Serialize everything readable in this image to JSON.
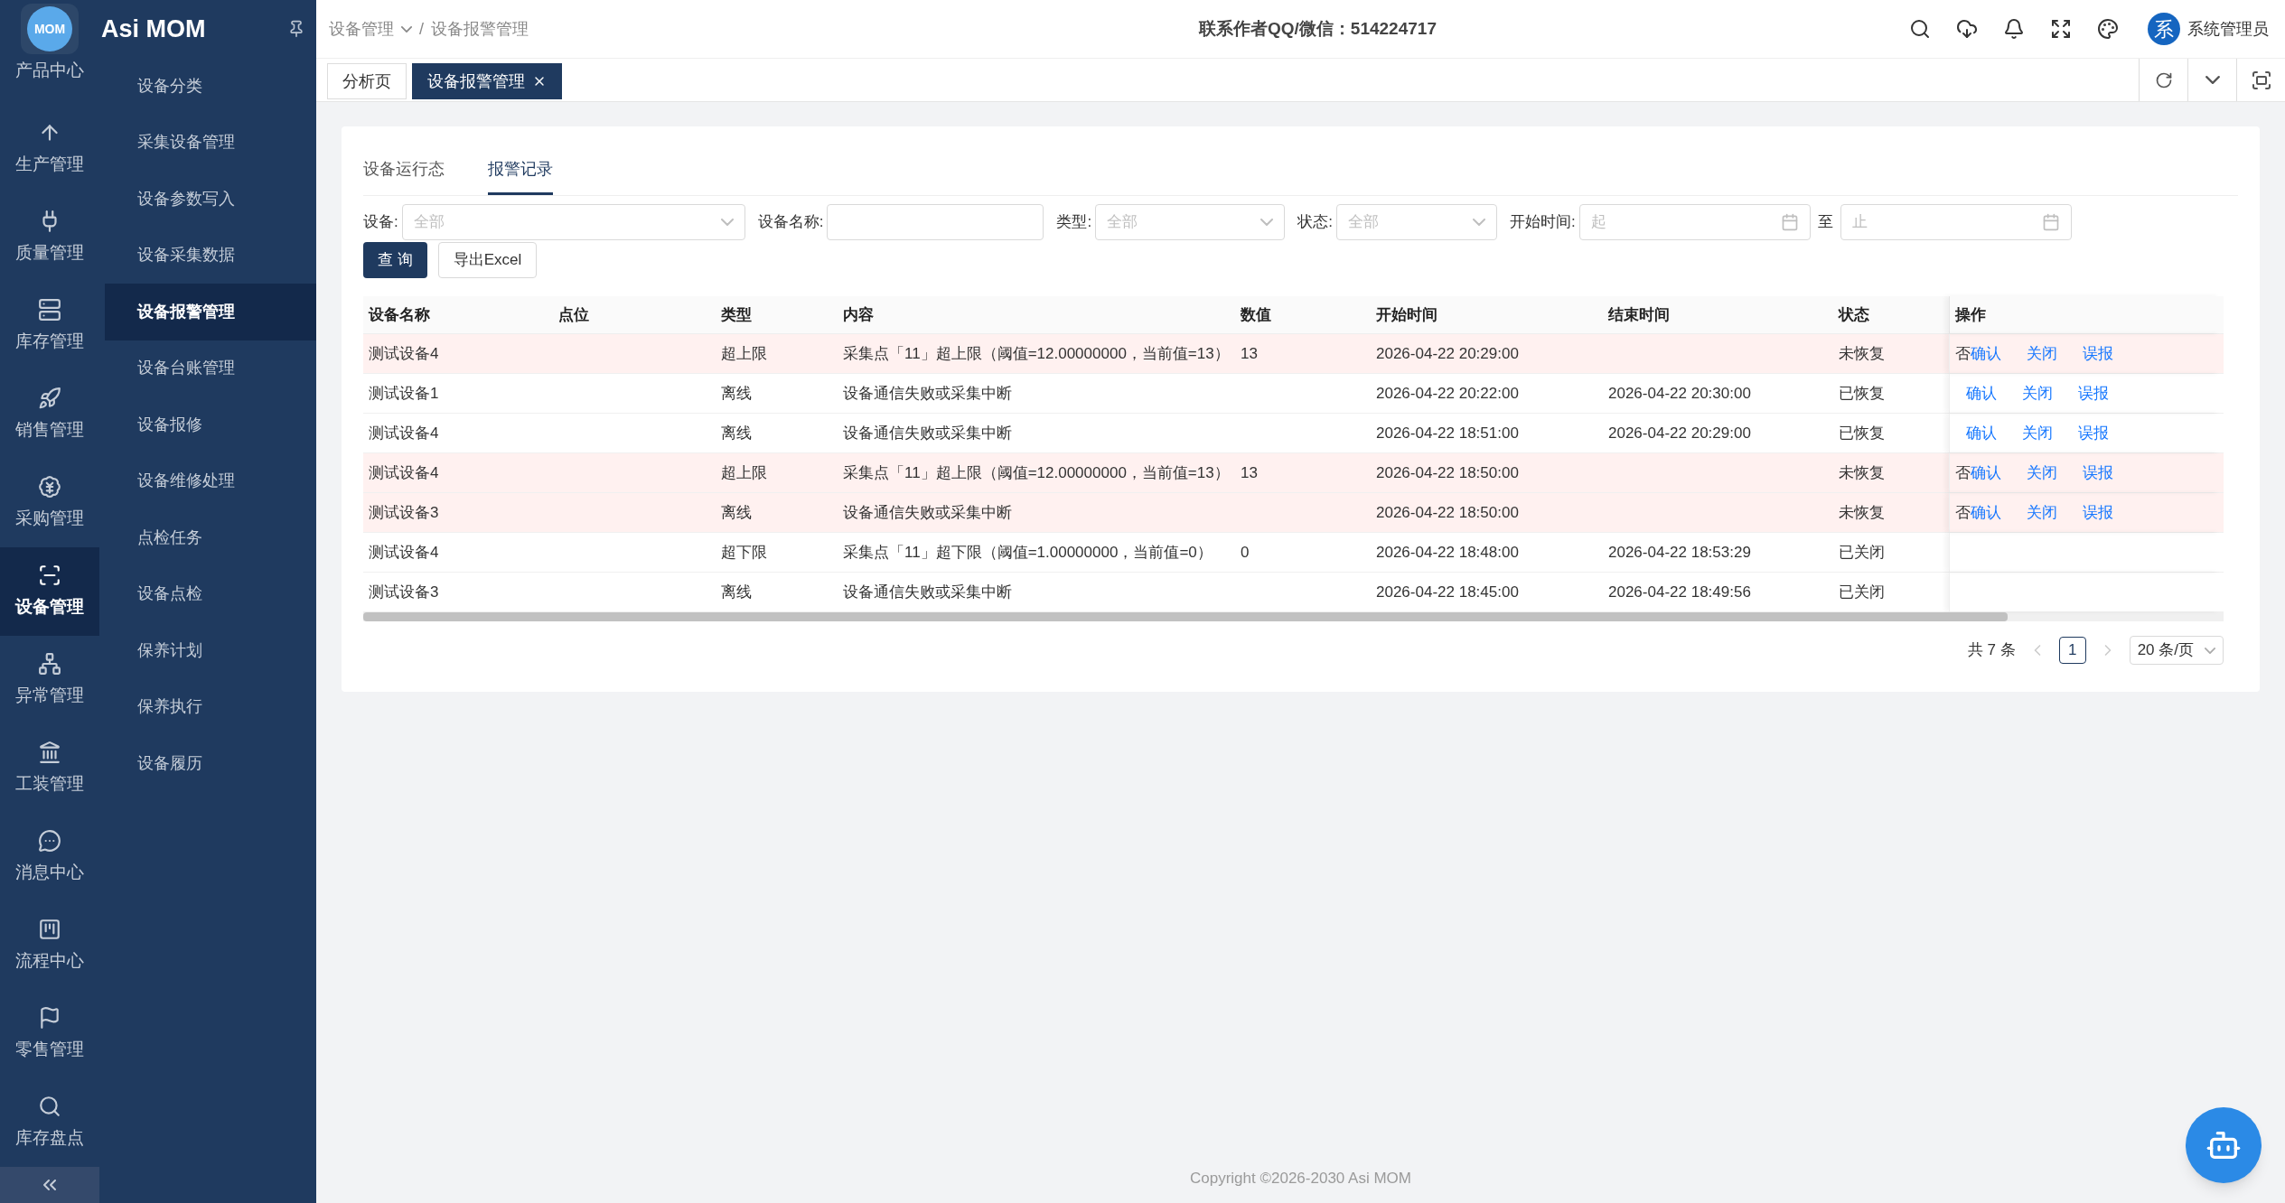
{
  "app": {
    "name": "Asi MOM",
    "logo": "MOM"
  },
  "nav": [
    {
      "label": "产品中心",
      "selected": false
    },
    {
      "label": "生产管理",
      "selected": false
    },
    {
      "label": "质量管理",
      "selected": false
    },
    {
      "label": "库存管理",
      "selected": false
    },
    {
      "label": "销售管理",
      "selected": false
    },
    {
      "label": "采购管理",
      "selected": false
    },
    {
      "label": "设备管理",
      "selected": true
    },
    {
      "label": "异常管理",
      "selected": false
    },
    {
      "label": "工装管理",
      "selected": false
    },
    {
      "label": "消息中心",
      "selected": false
    },
    {
      "label": "流程中心",
      "selected": false
    },
    {
      "label": "零售管理",
      "selected": false
    },
    {
      "label": "库存盘点",
      "selected": false
    }
  ],
  "submenu": [
    {
      "label": "设备分类",
      "selected": false
    },
    {
      "label": "采集设备管理",
      "selected": false
    },
    {
      "label": "设备参数写入",
      "selected": false
    },
    {
      "label": "设备采集数据",
      "selected": false
    },
    {
      "label": "设备报警管理",
      "selected": true
    },
    {
      "label": "设备台账管理",
      "selected": false
    },
    {
      "label": "设备报修",
      "selected": false
    },
    {
      "label": "设备维修处理",
      "selected": false
    },
    {
      "label": "点检任务",
      "selected": false
    },
    {
      "label": "设备点检",
      "selected": false
    },
    {
      "label": "保养计划",
      "selected": false
    },
    {
      "label": "保养执行",
      "selected": false
    },
    {
      "label": "设备履历",
      "selected": false
    }
  ],
  "breadcrumb": {
    "items": [
      "设备管理",
      "设备报警管理"
    ],
    "separator": "/"
  },
  "contact": "联系作者QQ/微信：514224717",
  "user": {
    "avatar": "系",
    "name": "系统管理员"
  },
  "page_tabs": [
    {
      "label": "分析页",
      "selected": false,
      "closable": false
    },
    {
      "label": "设备报警管理",
      "selected": true,
      "closable": true
    }
  ],
  "view_tabs": [
    {
      "label": "设备运行态",
      "selected": false
    },
    {
      "label": "报警记录",
      "selected": true
    }
  ],
  "filters": [
    {
      "kind": "select",
      "label": "设备:",
      "placeholder": "全部"
    },
    {
      "kind": "text",
      "label": "设备名称:"
    },
    {
      "kind": "select",
      "label": "类型:",
      "placeholder": "全部"
    },
    {
      "kind": "select",
      "label": "状态:",
      "placeholder": "全部"
    },
    {
      "kind": "date_range",
      "label": "开始时间:",
      "from_placeholder": "起",
      "separator": "至",
      "to_placeholder": "止"
    }
  ],
  "buttons": [
    {
      "kind": "primary",
      "label": "查 询"
    },
    {
      "kind": "default",
      "label": "导出Excel"
    }
  ],
  "table": {
    "columns": [
      "设备名称",
      "点位",
      "类型",
      "内容",
      "数值",
      "开始时间",
      "结束时间",
      "状态",
      "操作"
    ],
    "rows": [
      {
        "highlighted": true,
        "device": "测试设备4",
        "type": "超上限",
        "content": "采集点「11」超上限（阈值=12.00000000，当前值=13）",
        "value": "13",
        "start": "2026-04-22 20:29:00",
        "status": "未恢复",
        "flag": "否",
        "actions": [
          "确认",
          "关闭",
          "误报"
        ]
      },
      {
        "highlighted": false,
        "device": "测试设备1",
        "type": "离线",
        "content": "设备通信失败或采集中断",
        "start": "2026-04-22 20:22:00",
        "end": "2026-04-22 20:30:00",
        "status": "已恢复",
        "actions": [
          "确认",
          "关闭",
          "误报"
        ]
      },
      {
        "highlighted": false,
        "device": "测试设备4",
        "type": "离线",
        "content": "设备通信失败或采集中断",
        "start": "2026-04-22 18:51:00",
        "end": "2026-04-22 20:29:00",
        "status": "已恢复",
        "actions": [
          "确认",
          "关闭",
          "误报"
        ]
      },
      {
        "highlighted": true,
        "device": "测试设备4",
        "type": "超上限",
        "content": "采集点「11」超上限（阈值=12.00000000，当前值=13）",
        "value": "13",
        "start": "2026-04-22 18:50:00",
        "status": "未恢复",
        "flag": "否",
        "actions": [
          "确认",
          "关闭",
          "误报"
        ]
      },
      {
        "highlighted": true,
        "device": "测试设备3",
        "type": "离线",
        "content": "设备通信失败或采集中断",
        "start": "2026-04-22 18:50:00",
        "status": "未恢复",
        "flag": "否",
        "actions": [
          "确认",
          "关闭",
          "误报"
        ]
      },
      {
        "highlighted": false,
        "device": "测试设备4",
        "type": "超下限",
        "content": "采集点「11」超下限（阈值=1.00000000，当前值=0）",
        "value": "0",
        "start": "2026-04-22 18:48:00",
        "end": "2026-04-22 18:53:29",
        "status": "已关闭"
      },
      {
        "highlighted": false,
        "device": "测试设备3",
        "type": "离线",
        "content": "设备通信失败或采集中断",
        "start": "2026-04-22 18:45:00",
        "end": "2026-04-22 18:49:56",
        "status": "已关闭"
      }
    ]
  },
  "pagination": {
    "total": "共 7 条",
    "pages": [
      {
        "label": "1",
        "selected": true
      }
    ],
    "page_size": "20 条/页"
  },
  "footer": "Copyright ©2026-2030 Asi MOM"
}
